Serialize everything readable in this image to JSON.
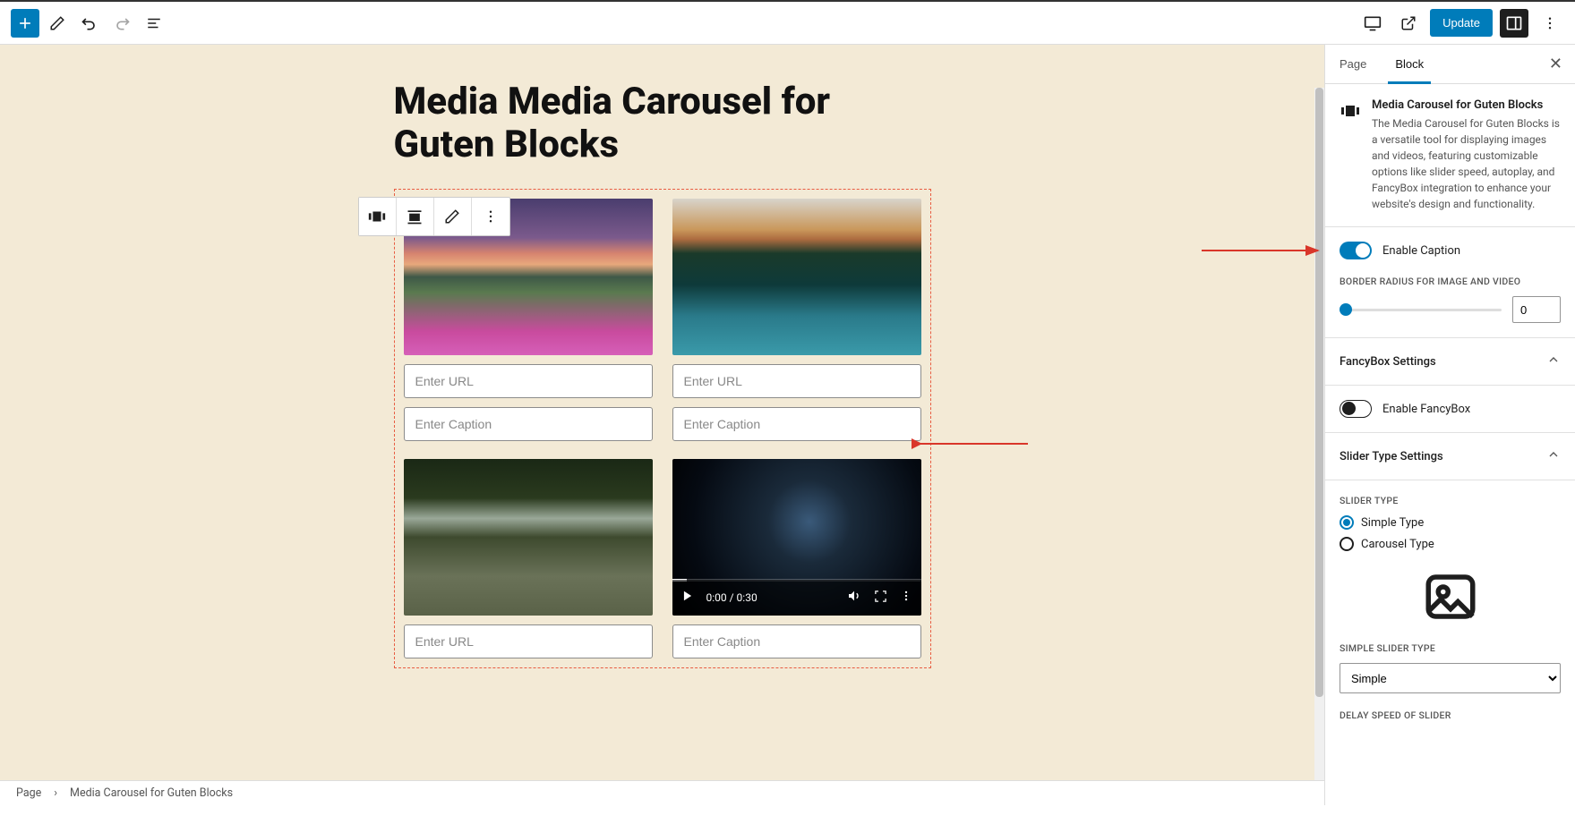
{
  "topbar": {
    "update_label": "Update"
  },
  "page": {
    "title": "Media Media Carousel for Guten Blocks"
  },
  "block_toolbar": {},
  "media": {
    "url_placeholder": "Enter URL",
    "caption_placeholder": "Enter Caption",
    "video_time": "0:00 / 0:30"
  },
  "sidebar": {
    "tabs": {
      "page": "Page",
      "block": "Block"
    },
    "block_name": "Media Carousel for Guten Blocks",
    "block_desc": "The Media Carousel for Guten Blocks is a versatile tool for displaying images and videos, featuring customizable options like slider speed, autoplay, and FancyBox integration to enhance your website's design and functionality.",
    "enable_caption": "Enable Caption",
    "border_radius_label": "BORDER RADIUS FOR IMAGE AND VIDEO",
    "border_radius_value": "0",
    "fancybox_title": "FancyBox Settings",
    "enable_fancybox": "Enable FancyBox",
    "slider_type_title": "Slider Type Settings",
    "slider_type_label": "SLIDER TYPE",
    "slider_type_simple": "Simple Type",
    "slider_type_carousel": "Carousel Type",
    "simple_slider_type_label": "SIMPLE SLIDER TYPE",
    "simple_slider_type_value": "Simple",
    "delay_speed_label": "DELAY SPEED OF SLIDER"
  },
  "breadcrumb": {
    "root": "Page",
    "current": "Media Carousel for Guten Blocks"
  }
}
